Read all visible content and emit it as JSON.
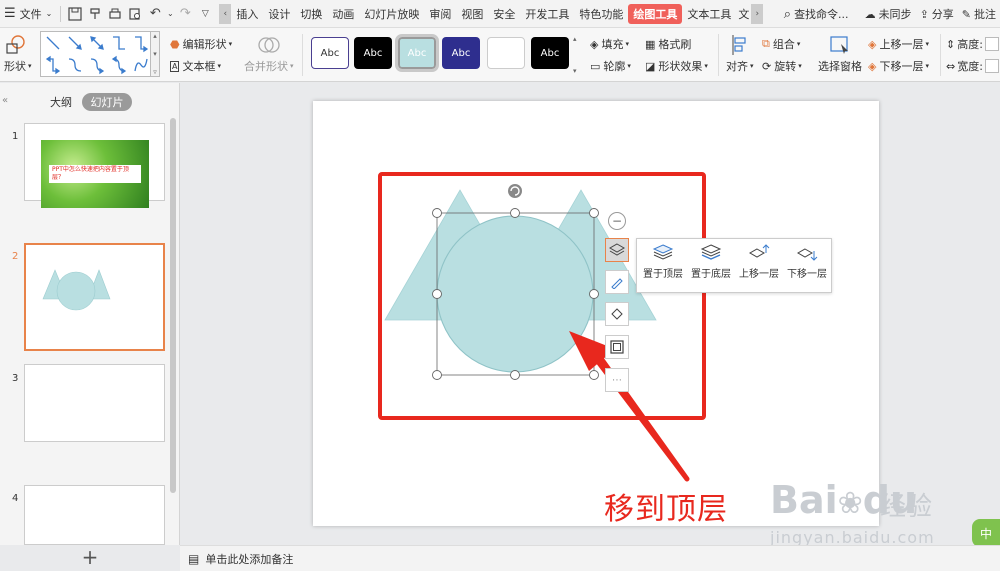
{
  "menubar": {
    "file_label": "文件",
    "tabs": [
      "插入",
      "设计",
      "切换",
      "动画",
      "幻灯片放映",
      "审阅",
      "视图",
      "安全",
      "开发工具",
      "特色功能",
      "绘图工具",
      "文本工具"
    ],
    "active_tab": "绘图工具",
    "truncated_tab": "文",
    "search_label": "查找命令...",
    "sync_label": "未同步",
    "share_label": "分享",
    "annotate_label": "批注"
  },
  "ribbon": {
    "shape_label": "形状",
    "edit_shape_label": "编辑形状",
    "textbox_label": "文本框",
    "merge_shape_label": "合并形状",
    "style_sample_label": "Abc",
    "fill_label": "填充",
    "format_brush_label": "格式刷",
    "outline_label": "轮廓",
    "shape_effect_label": "形状效果",
    "align_label": "对齐",
    "group_label": "组合",
    "rotate_label": "旋转",
    "select_pane_label": "选择窗格",
    "bring_forward_label": "上移一层",
    "send_backward_label": "下移一层",
    "height_label": "高度:",
    "width_label": "宽度:"
  },
  "leftpanel": {
    "outline_tab": "大纲",
    "slides_tab": "幻灯片",
    "slides": [
      {
        "num": "1",
        "text": "PPT中怎么快速把内容置于顶层？"
      },
      {
        "num": "2"
      },
      {
        "num": "3"
      },
      {
        "num": "4"
      }
    ],
    "add_label": "+"
  },
  "statusbar": {
    "note_label": "单击此处添加备注"
  },
  "layer_popup": {
    "items": [
      "置于顶层",
      "置于底层",
      "上移一层",
      "下移一层"
    ]
  },
  "annotation": {
    "text": "移到顶层"
  },
  "watermark": {
    "logo": "Bai",
    "logo_end": "du",
    "cn": "经验",
    "url": "jingyan.baidu.com"
  },
  "badge": {
    "text": "中"
  },
  "colors": {
    "shape_fill": "#b9dfe1",
    "shape_stroke": "#8fc3c7",
    "annotation_red": "#e8281e",
    "active_tab": "#f0605a",
    "selected_thumb": "#e8834a"
  }
}
